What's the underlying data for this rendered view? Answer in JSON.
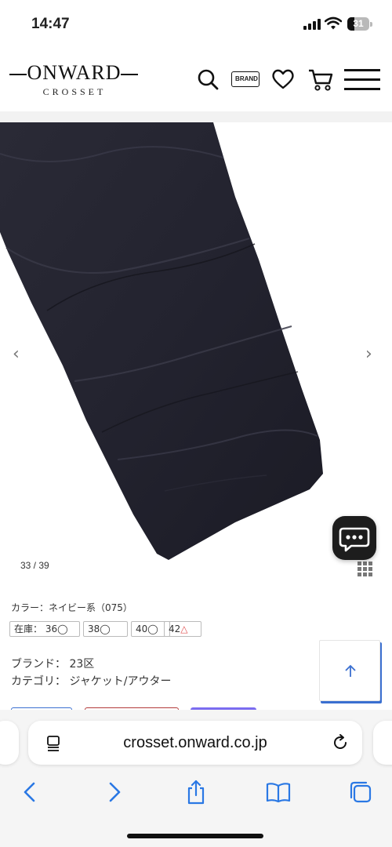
{
  "status_bar": {
    "time": "14:47",
    "battery_level": "31",
    "battery_fraction": 0.31
  },
  "header": {
    "logo_main": "ONWARD",
    "logo_sub": "CROSSET",
    "brand_tag": "BRAND"
  },
  "icons": {
    "search": "search-icon",
    "brand": "brand-tag-icon",
    "favorite": "heart-icon",
    "cart": "cart-icon",
    "menu": "hamburger-menu-icon",
    "chat": "chat-icon",
    "to_top": "arrow-up-icon",
    "grid": "grid-icon"
  },
  "gallery": {
    "prev_arrow": "‹",
    "next_arrow": "›",
    "counter": "33 / 39",
    "image_color": "#23232f"
  },
  "product": {
    "color_line": "カラー：ネイビー系（075）",
    "stock_label": "在庫：",
    "sizes": [
      {
        "size": "36",
        "mark": "◯"
      },
      {
        "size": "38",
        "mark": "◯"
      },
      {
        "size": "40",
        "mark": "◯"
      },
      {
        "size": "42",
        "mark": "△"
      }
    ],
    "brand_line": "ブランド： 23区",
    "category_line": "カテゴリ： ジャケット/アウター"
  },
  "browser": {
    "url": "crosset.onward.co.jp"
  },
  "colors": {
    "accent_blue": "#3a6fd0",
    "partial_red": "#b23a3a",
    "partial_purple": "#7b6cf0",
    "ios_blue": "#2a78e4"
  }
}
